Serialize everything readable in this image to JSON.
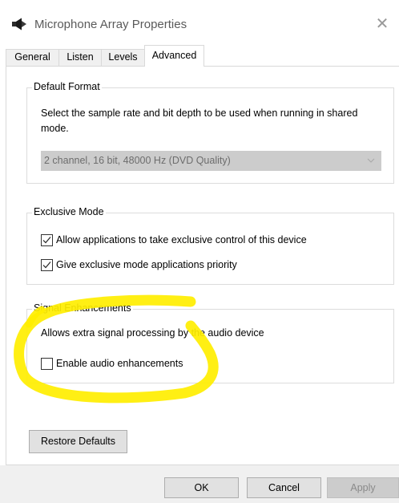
{
  "window": {
    "title": "Microphone Array Properties",
    "app_icon": "speaker-icon",
    "close_icon": "close-icon",
    "close_glyph": "✕"
  },
  "tabs": [
    {
      "label": "General",
      "active": false
    },
    {
      "label": "Listen",
      "active": false
    },
    {
      "label": "Levels",
      "active": false
    },
    {
      "label": "Advanced",
      "active": true
    }
  ],
  "default_format": {
    "legend": "Default Format",
    "description": "Select the sample rate and bit depth to be used when running in shared mode.",
    "selected_value": "2 channel, 16 bit, 48000 Hz (DVD Quality)",
    "enabled": false
  },
  "exclusive_mode": {
    "legend": "Exclusive Mode",
    "options": [
      {
        "label": "Allow applications to take exclusive control of this device",
        "checked": true
      },
      {
        "label": "Give exclusive mode applications priority",
        "checked": true
      }
    ]
  },
  "signal_enhancements": {
    "legend": "Signal Enhancements",
    "description": "Allows extra signal processing by the audio device",
    "enable_label": "Enable audio enhancements",
    "enable_checked": false
  },
  "buttons": {
    "restore_defaults": "Restore Defaults",
    "ok": "OK",
    "cancel": "Cancel",
    "apply": "Apply",
    "apply_enabled": false
  },
  "annotation": {
    "color": "#ffee00",
    "shape": "hand-drawn circle around Signal Enhancements"
  },
  "colors": {
    "panel_border": "#d9d9d9",
    "disabled_combo": "#cccccc",
    "button_face": "#e1e1e1",
    "dialog_background": "#f0f0f0"
  }
}
